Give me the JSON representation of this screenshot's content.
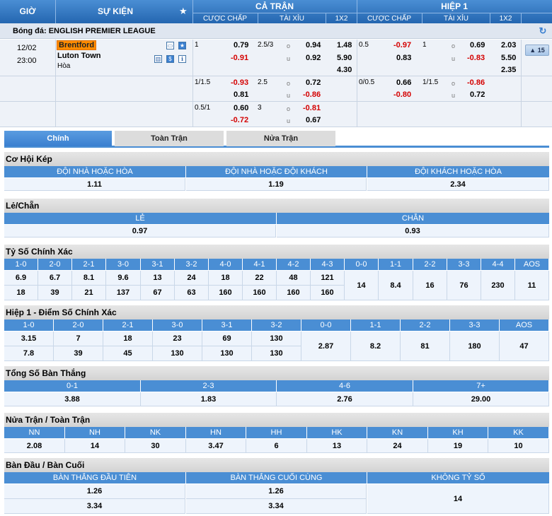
{
  "header": {
    "gio": "GIỜ",
    "su_kien": "SỰ KIỆN",
    "ca_tran": "CẢ TRẬN",
    "hiep1": "HIỆP 1",
    "cuoc_chap": "CƯỢC CHẤP",
    "tai_xiu": "TÀI XỈU",
    "x12": "1X2"
  },
  "league": "Bóng đá: ENGLISH PREMIER LEAGUE",
  "match": {
    "date": "12/02",
    "time": "23:00",
    "home": "Brentford",
    "away": "Luton Town",
    "draw": "Hòa",
    "more_count": "15"
  },
  "odds_rows": [
    {
      "ft_hdp": "1",
      "ft_hdp_h": "0.79",
      "ft_hdp_a": "-0.91",
      "ft_ou": "2.5/3",
      "ft_o": "o",
      "ft_u": "u",
      "ft_ou_o": "0.94",
      "ft_ou_u": "0.92",
      "x1": "1.48",
      "x2": "5.90",
      "xx": "4.30",
      "h1_hdp": "0.5",
      "h1_hdp_h": "-0.97",
      "h1_hdp_a": "0.83",
      "h1_ou": "1",
      "h1_o": "o",
      "h1_u": "u",
      "h1_ou_o": "0.69",
      "h1_ou_u": "-0.83",
      "h1_x1": "2.03",
      "h1_x2": "5.50",
      "h1_xx": "2.35"
    },
    {
      "ft_hdp": "1/1.5",
      "ft_hdp_h": "-0.93",
      "ft_hdp_a": "0.81",
      "ft_ou": "2.5",
      "ft_o": "o",
      "ft_u": "u",
      "ft_ou_o": "0.72",
      "ft_ou_u": "-0.86",
      "h1_hdp": "0/0.5",
      "h1_hdp_h": "0.66",
      "h1_hdp_a": "-0.80",
      "h1_ou": "1/1.5",
      "h1_o": "o",
      "h1_u": "u",
      "h1_ou_o": "-0.86",
      "h1_ou_u": "0.72"
    },
    {
      "ft_hdp": "0.5/1",
      "ft_hdp_h": "0.60",
      "ft_hdp_a": "-0.72",
      "ft_ou": "3",
      "ft_o": "o",
      "ft_u": "u",
      "ft_ou_o": "-0.81",
      "ft_ou_u": "0.67"
    }
  ],
  "tabs": [
    "Chính",
    "Toàn Trận",
    "Nửa Trận"
  ],
  "sections": {
    "double_chance": {
      "title": "Cơ Hội Kép",
      "headers": [
        "ĐỘI NHÀ HOẶC HÒA",
        "ĐỘI NHÀ HOẶC ĐỘI KHÁCH",
        "ĐỘI KHÁCH HOẶC HÒA"
      ],
      "values": [
        "1.11",
        "1.19",
        "2.34"
      ]
    },
    "odd_even": {
      "title": "Lẻ/Chẵn",
      "headers": [
        "LẺ",
        "CHẴN"
      ],
      "values": [
        "0.97",
        "0.93"
      ]
    },
    "correct_score": {
      "title": "Tỷ Số Chính Xác",
      "headers": [
        "1-0",
        "2-0",
        "2-1",
        "3-0",
        "3-1",
        "3-2",
        "4-0",
        "4-1",
        "4-2",
        "4-3",
        "0-0",
        "1-1",
        "2-2",
        "3-3",
        "4-4",
        "AOS"
      ],
      "home": [
        "6.9",
        "6.7",
        "8.1",
        "9.6",
        "13",
        "24",
        "18",
        "22",
        "48",
        "121"
      ],
      "away": [
        "18",
        "39",
        "21",
        "137",
        "67",
        "63",
        "160",
        "160",
        "160",
        "160"
      ],
      "draws": [
        "14",
        "8.4",
        "16",
        "76",
        "230",
        "11"
      ]
    },
    "h1_correct_score": {
      "title": "Hiệp 1 - Điểm Số Chính Xác",
      "headers": [
        "1-0",
        "2-0",
        "2-1",
        "3-0",
        "3-1",
        "3-2",
        "0-0",
        "1-1",
        "2-2",
        "3-3",
        "AOS"
      ],
      "home": [
        "3.15",
        "7",
        "18",
        "23",
        "69",
        "130"
      ],
      "away": [
        "7.8",
        "39",
        "45",
        "130",
        "130",
        "130"
      ],
      "draws": [
        "2.87",
        "8.2",
        "81",
        "180",
        "47"
      ]
    },
    "total_goals": {
      "title": "Tổng Số Bàn Thắng",
      "headers": [
        "0-1",
        "2-3",
        "4-6",
        "7+"
      ],
      "values": [
        "3.88",
        "1.83",
        "2.76",
        "29.00"
      ]
    },
    "htft": {
      "title": "Nửa Trận / Toàn Trận",
      "headers": [
        "NN",
        "NH",
        "NK",
        "HN",
        "HH",
        "HK",
        "KN",
        "KH",
        "KK"
      ],
      "values": [
        "2.08",
        "14",
        "30",
        "3.47",
        "6",
        "13",
        "24",
        "19",
        "10"
      ]
    },
    "first_last": {
      "title": "Bàn Đầu / Bàn Cuối",
      "headers": [
        "BÀN THẮNG ĐẦU TIÊN",
        "BÀN THẮNG CUỐI CÙNG",
        "KHÔNG TỶ SỐ"
      ],
      "first": [
        "1.26",
        "3.34"
      ],
      "last": [
        "1.26",
        "3.34"
      ],
      "none": "14"
    }
  }
}
